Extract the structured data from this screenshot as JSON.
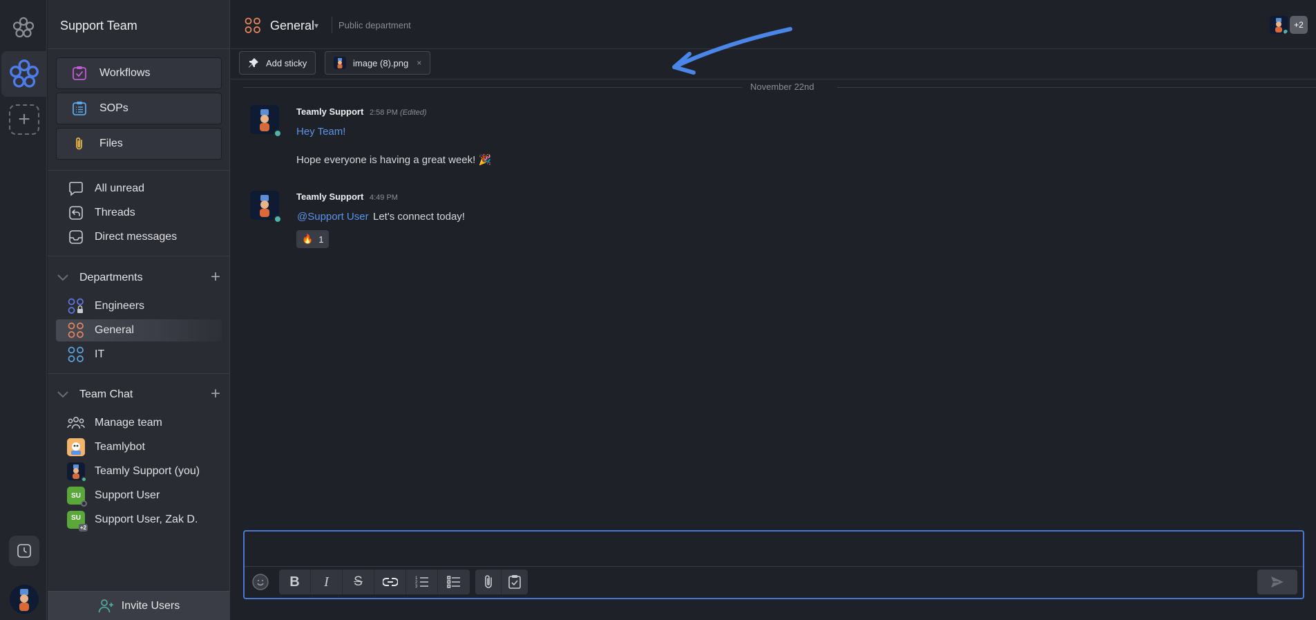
{
  "workspace": {
    "name": "Support Team"
  },
  "sidebar": {
    "quick_buttons": [
      {
        "label": "Workflows",
        "icon": "workflow-icon",
        "color": "#c25bd8"
      },
      {
        "label": "SOPs",
        "icon": "sop-list-icon",
        "color": "#5aa8e8"
      },
      {
        "label": "Files",
        "icon": "paperclip-icon",
        "color": "#e0b04a"
      }
    ],
    "nav": [
      {
        "label": "All unread",
        "icon": "chat-bubble-icon"
      },
      {
        "label": "Threads",
        "icon": "threads-icon"
      },
      {
        "label": "Direct messages",
        "icon": "inbox-icon"
      }
    ],
    "departments": {
      "title": "Departments",
      "items": [
        {
          "label": "Engineers",
          "icon": "department-lock-icon",
          "color": "#5b7be8"
        },
        {
          "label": "General",
          "icon": "department-icon",
          "color": "#e8875b",
          "active": true
        },
        {
          "label": "IT",
          "icon": "department-icon",
          "color": "#5aa8e8"
        }
      ]
    },
    "team_chat": {
      "title": "Team Chat",
      "items": [
        {
          "label": "Manage team",
          "icon": "team-icon"
        },
        {
          "label": "Teamlybot",
          "icon": "bot-avatar"
        },
        {
          "label": "Teamly Support (you)",
          "icon": "support-avatar"
        },
        {
          "label": "Support User",
          "initials": "SU",
          "color": "#5aa83a"
        },
        {
          "label": "Support User, Zak D.",
          "initials": "SU",
          "badge": "+2",
          "color": "#5aa83a"
        }
      ]
    },
    "invite_label": "Invite Users"
  },
  "header": {
    "channel": "General",
    "subtitle": "Public department",
    "participants_more": "+2"
  },
  "toolbar": {
    "add_sticky": "Add sticky",
    "attachment": "image (8).png",
    "attachment_close": "×"
  },
  "date_divider": "November 22nd",
  "messages": [
    {
      "author": "Teamly Support",
      "time": "2:58 PM",
      "edited": "(Edited)",
      "line1": "Hey Team!",
      "line2": "Hope everyone is having a great week! 🎉"
    },
    {
      "author": "Teamly Support",
      "time": "4:49 PM",
      "mention": "@Support User",
      "text": "Let's connect today!",
      "reaction_emoji": "🔥",
      "reaction_count": "1"
    }
  ],
  "composer": {
    "placeholder": ""
  },
  "colors": {
    "accent": "#4a78d8",
    "link": "#5b93e8",
    "online": "#4fb3a8"
  }
}
